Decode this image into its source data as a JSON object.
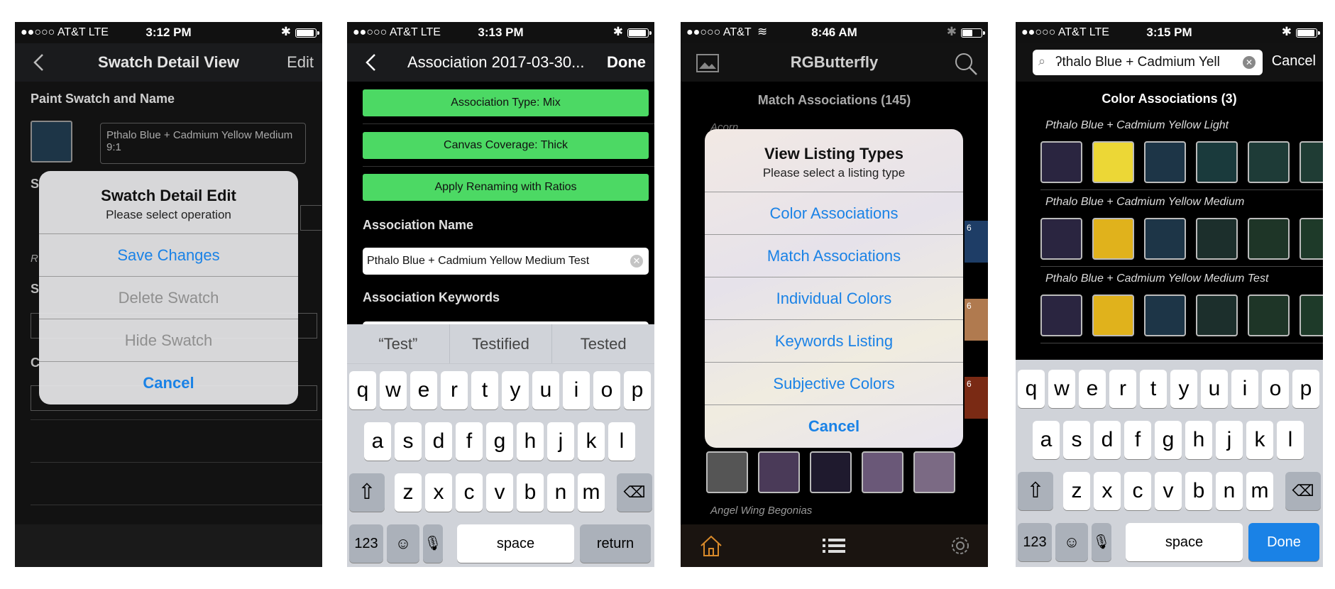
{
  "screens": [
    {
      "status": {
        "carrier": "●●○○○ AT&T  LTE",
        "time": "3:12 PM"
      },
      "nav": {
        "title": "Swatch Detail View",
        "right": "Edit"
      },
      "section_title": "Paint Swatch and Name",
      "name_value": "Pthalo Blue + Cadmium Yellow Medium 9:1",
      "partial_labels": [
        "S",
        "R",
        "S",
        "C"
      ],
      "alert": {
        "title": "Swatch Detail Edit",
        "subtitle": "Please select operation",
        "buttons": [
          "Save Changes",
          "Delete Swatch",
          "Hide Swatch",
          "Cancel"
        ]
      }
    },
    {
      "status": {
        "carrier": "●●○○○ AT&T  LTE",
        "time": "3:13 PM"
      },
      "nav": {
        "title": "Association 2017-03-30...",
        "right": "Done"
      },
      "buttons": [
        "Association Type: Mix",
        "Canvas Coverage: Thick",
        "Apply Renaming with Ratios"
      ],
      "name_label": "Association Name",
      "name_value": "Pthalo Blue + Cadmium Yellow Medium Test",
      "keywords_label": "Association Keywords",
      "suggestions": [
        "“Test”",
        "Testified",
        "Tested"
      ],
      "keys": {
        "row1": [
          "q",
          "w",
          "e",
          "r",
          "t",
          "y",
          "u",
          "i",
          "o",
          "p"
        ],
        "row2": [
          "a",
          "s",
          "d",
          "f",
          "g",
          "h",
          "j",
          "k",
          "l"
        ],
        "row3": [
          "z",
          "x",
          "c",
          "v",
          "b",
          "n",
          "m"
        ],
        "numbers": "123",
        "space": "space",
        "return": "return"
      }
    },
    {
      "status": {
        "carrier": "●●○○○ AT&T",
        "time": "8:46 AM"
      },
      "nav": {
        "title": "RGButterfly"
      },
      "header": "Match Associations (145)",
      "bg_label_top": "Acorn",
      "bg_label_bottom": "Angel Wing Begonias",
      "side_counts": [
        "6",
        "6",
        "6"
      ],
      "alert": {
        "title": "View Listing Types",
        "subtitle": "Please select a listing type",
        "buttons": [
          "Color Associations",
          "Match Associations",
          "Individual Colors",
          "Keywords Listing",
          "Subjective Colors",
          "Cancel"
        ]
      }
    },
    {
      "status": {
        "carrier": "●●○○○ AT&T  LTE",
        "time": "3:15 PM"
      },
      "search_value": "ʔthalo Blue + Cadmium Yell",
      "cancel": "Cancel",
      "header": "Color Associations (3)",
      "rows": [
        {
          "title": "Pthalo Blue + Cadmium Yellow Light",
          "colors": [
            "#2a2540",
            "#ecd736",
            "#1d3547",
            "#1a3a3c",
            "#1e3b37",
            "#1f3c34"
          ]
        },
        {
          "title": "Pthalo Blue + Cadmium Yellow Medium",
          "colors": [
            "#2a2540",
            "#e0b21c",
            "#1d3547",
            "#1c2f2c",
            "#1e3527",
            "#1e3a29"
          ]
        },
        {
          "title": "Pthalo Blue + Cadmium Yellow Medium Test",
          "colors": [
            "#2a2540",
            "#e0b21c",
            "#1d3547",
            "#1c2f2c",
            "#1e3527",
            "#1e3a29"
          ]
        }
      ],
      "keys": {
        "row1": [
          "q",
          "w",
          "e",
          "r",
          "t",
          "y",
          "u",
          "i",
          "o",
          "p"
        ],
        "row2": [
          "a",
          "s",
          "d",
          "f",
          "g",
          "h",
          "j",
          "k",
          "l"
        ],
        "row3": [
          "z",
          "x",
          "c",
          "v",
          "b",
          "n",
          "m"
        ],
        "numbers": "123",
        "space": "space",
        "done": "Done"
      }
    }
  ],
  "colors": {
    "accent": "#1a82e6",
    "green": "#4cd964",
    "swatch_blue": "#1d3547"
  }
}
